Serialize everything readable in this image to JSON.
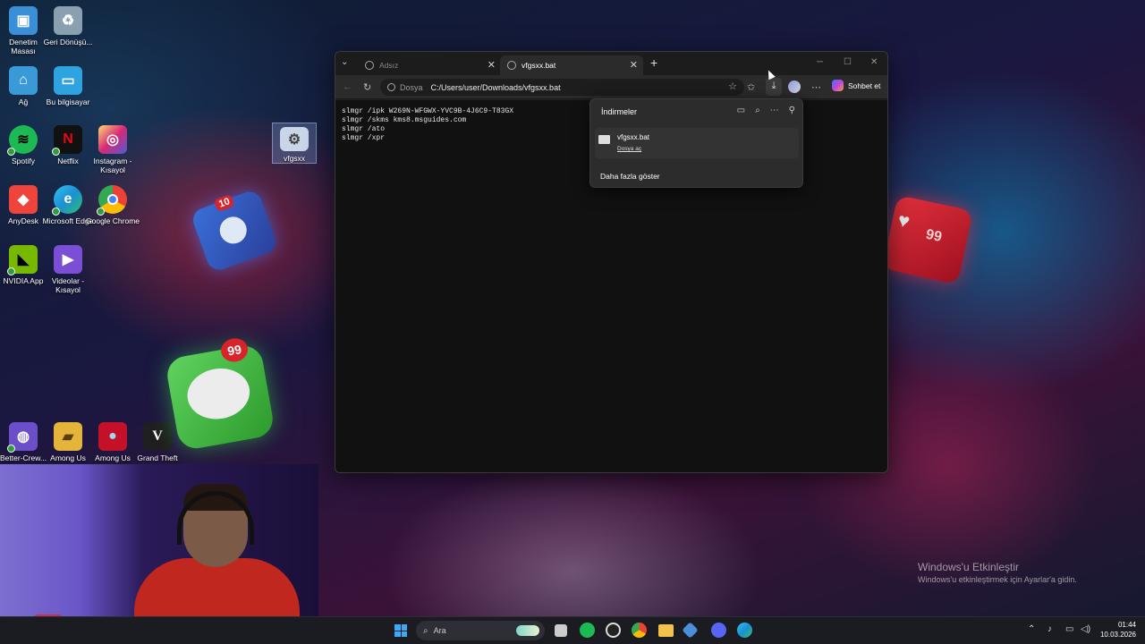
{
  "desktop": {
    "icons": [
      {
        "label": "Denetim Masası",
        "color": "#3a8fd6",
        "glyph": "▣"
      },
      {
        "label": "Geri Dönüşü...",
        "color": "#8aa0b0",
        "glyph": "♻"
      },
      {
        "label": "Ağ",
        "color": "#3a9ad8",
        "glyph": "🖧"
      },
      {
        "label": "Bu bilgisayar",
        "color": "#2fa3e0",
        "glyph": "▭"
      },
      {
        "label": "Spotify",
        "color": "#1db954",
        "glyph": "≋"
      },
      {
        "label": "Netflix",
        "color": "#111111",
        "glyph": "N"
      },
      {
        "label": "Instagram - Kısayol",
        "color": "#d6249f",
        "glyph": "◎"
      },
      {
        "label": "AnyDesk",
        "color": "#ef443b",
        "glyph": "◆"
      },
      {
        "label": "Microsoft Edge",
        "color": "#1b8fd2",
        "glyph": "e"
      },
      {
        "label": "Google Chrome",
        "color": "#e8453c",
        "glyph": "◉"
      },
      {
        "label": "NVIDIA App",
        "color": "#76b900",
        "glyph": "◣"
      },
      {
        "label": "Videolar - Kısayol",
        "color": "#7a4fd6",
        "glyph": "▶"
      },
      {
        "label": "vfgsxx",
        "color": "#c9d6e8",
        "glyph": "⚙"
      },
      {
        "label": "Better-Crew...",
        "color": "#6a4fc9",
        "glyph": "◍"
      },
      {
        "label": "Among Us",
        "color": "#e5b43a",
        "glyph": "▰"
      },
      {
        "label": "Among Us",
        "color": "#c5102a",
        "glyph": "●"
      },
      {
        "label": "Grand Theft Auto V",
        "color": "#1f1f1f",
        "glyph": "V"
      }
    ],
    "badges": {
      "phone": "10",
      "messages": "99",
      "heart": "99"
    }
  },
  "browser": {
    "tabs": [
      {
        "label": "Adsız",
        "active": false
      },
      {
        "label": "vfgsxx.bat",
        "active": true
      }
    ],
    "address": {
      "scheme": "Dosya",
      "url": "C:/Users/user/Downloads/vfgsxx.bat"
    },
    "copilot_label": "Sohbet et",
    "content_lines": [
      "slmgr /ipk W269N-WFGWX-YVC9B-4J6C9-T83GX",
      "slmgr /skms kms8.msguides.com",
      "slmgr /ato",
      "slmgr /xpr"
    ]
  },
  "downloads": {
    "title": "İndirmeler",
    "file_name": "vfgsxx.bat",
    "open_link": "Dosya aç",
    "more": "Daha fazla göster"
  },
  "watermark": {
    "title": "Windows'u Etkinleştir",
    "subtitle": "Windows'u etkinleştirmek için Ayarlar'a gidin."
  },
  "taskbar": {
    "search_placeholder": "Ara",
    "time": "01:44",
    "date": "10.03.2026"
  }
}
